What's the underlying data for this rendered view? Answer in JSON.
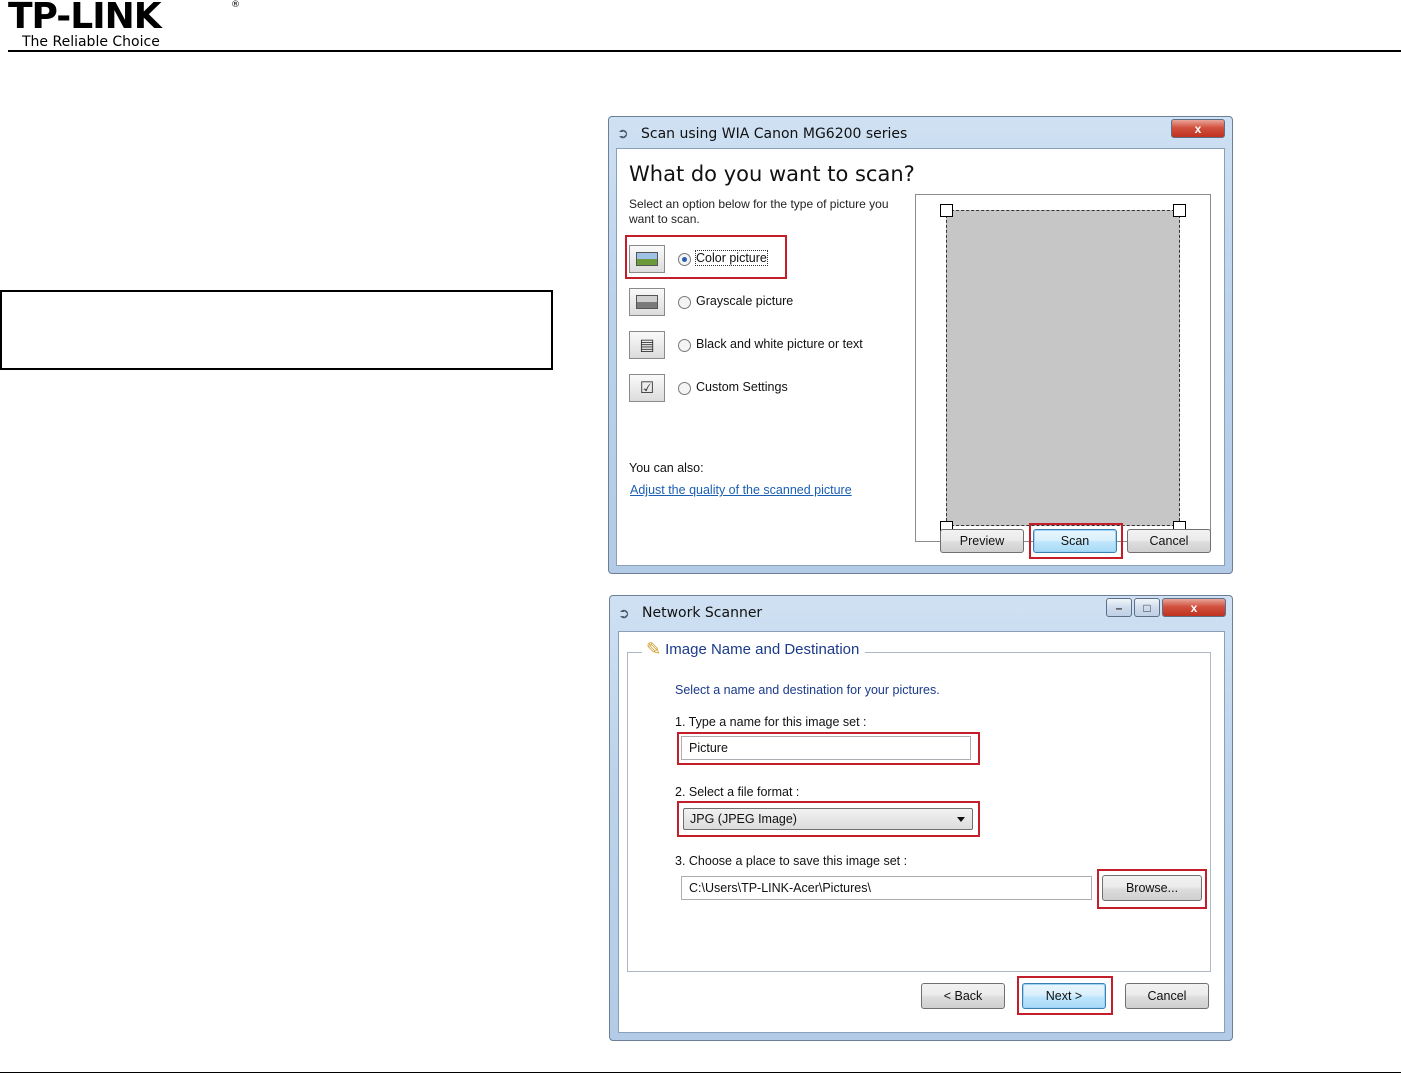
{
  "header": {
    "logo_text": "TP-LINK",
    "logo_mark": "®",
    "tagline": "The Reliable Choice"
  },
  "scan_dialog": {
    "title": "Scan using WIA Canon MG6200 series",
    "close_label": "x",
    "heading": "What do you want to scan?",
    "description": "Select an option below for the type of picture you want to scan.",
    "options": [
      {
        "label": "Color picture",
        "selected": true
      },
      {
        "label": "Grayscale picture",
        "selected": false
      },
      {
        "label": "Black and white picture or text",
        "selected": false
      },
      {
        "label": "Custom Settings",
        "selected": false
      }
    ],
    "also_label": "You can also:",
    "link_label": "Adjust the quality of the scanned picture",
    "buttons": {
      "preview": "Preview",
      "scan": "Scan",
      "cancel": "Cancel"
    }
  },
  "network_scanner": {
    "title": "Network Scanner",
    "minimize_label": "–",
    "maximize_label": "□",
    "close_label": "x",
    "section_title": "Image Name and Destination",
    "subtitle": "Select a name and destination for your pictures.",
    "step1_label": "1. Type a name for this image set :",
    "name_value": "Picture",
    "step2_label": "2. Select a file format :",
    "format_value": "JPG (JPEG Image)",
    "step3_label": "3. Choose a place to save this image set :",
    "path_value": "C:\\Users\\TP-LINK-Acer\\Pictures\\",
    "buttons": {
      "browse": "Browse...",
      "back": "< Back",
      "next": "Next >",
      "cancel": "Cancel"
    }
  },
  "colors": {
    "highlight": "#c41e2a",
    "link": "#1a5fb4",
    "section_title": "#1b3a8c"
  }
}
